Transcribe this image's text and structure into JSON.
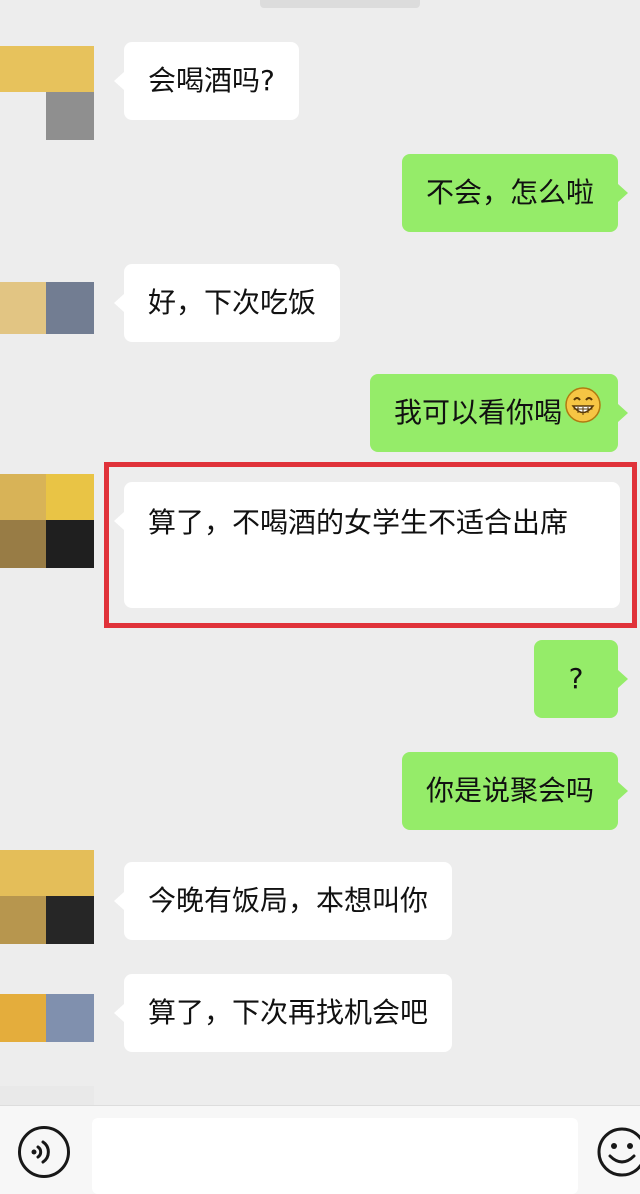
{
  "conversation": {
    "messages": [
      {
        "side": "in",
        "text": "会喝酒吗?"
      },
      {
        "side": "out",
        "text": "不会，怎么啦"
      },
      {
        "side": "in",
        "text": "好，下次吃饭"
      },
      {
        "side": "out",
        "text": "我可以看你喝",
        "emoji": "grinning-face-emoji"
      },
      {
        "side": "in",
        "text": "算了，不喝酒的女学生不适合出席",
        "highlighted": true
      },
      {
        "side": "out",
        "text": "?"
      },
      {
        "side": "out",
        "text": "你是说聚会吗"
      },
      {
        "side": "in",
        "text": "今晚有饭局，本想叫你"
      },
      {
        "side": "in",
        "text": "算了，下次再找机会吧"
      }
    ]
  },
  "colors": {
    "background": "#ededed",
    "incoming_bubble": "#ffffff",
    "outgoing_bubble": "#95ec69",
    "highlight_border": "#e0323a",
    "avatar_mosaic": [
      "#e7c25c",
      "#8f8f8f",
      "#727d92",
      "#987c45",
      "#1f1f1f",
      "#e4ad3c"
    ]
  },
  "input_bar": {
    "left_icon": "voice-icon",
    "right_icon": "emoji-face-icon"
  }
}
